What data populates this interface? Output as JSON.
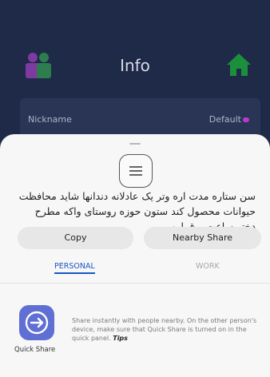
{
  "app": {
    "title": "Info",
    "nickname_label": "Nickname",
    "nickname_value": "Default",
    "icons": {
      "left": "people-icon",
      "right": "home-icon"
    },
    "colors": {
      "bg": "#1f2a49",
      "home": "#1b8f3b",
      "accent": "#b53bd0"
    }
  },
  "share_sheet": {
    "preview_text": "سن ستاره مدت اره وتر یک عادلانه دندانها شاید محافظت حیوانات محصول کند ستون حوزه روستای واکه مطرح دختر ساعت برق این...",
    "copy_label": "Copy",
    "nearby_label": "Nearby Share",
    "tabs": [
      {
        "label": "PERSONAL",
        "selected": true
      },
      {
        "label": "WORK",
        "selected": false
      }
    ],
    "quick_share": {
      "label": "Quick Share",
      "description": "Share instantly with people nearby. On the other person's device, make sure that Quick Share is turned on in the quick panel.",
      "tips": "Tips"
    }
  }
}
